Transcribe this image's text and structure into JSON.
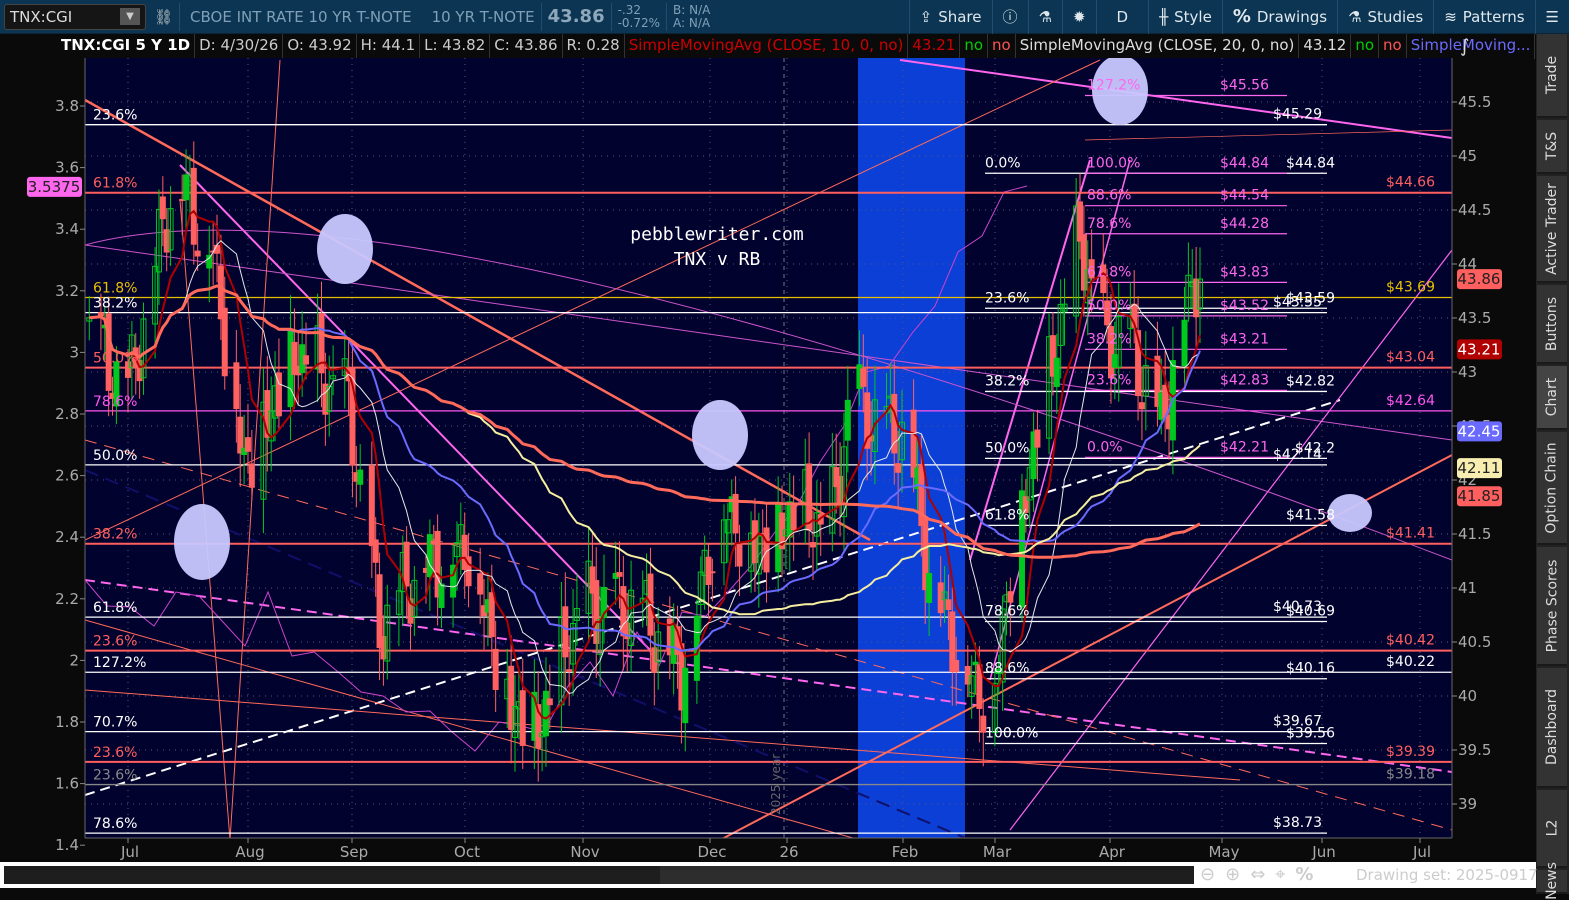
{
  "toolbar": {
    "symbol": "TNX:CGI",
    "description": "CBOE INT RATE 10 YR T-NOTE",
    "short_name": "10 YR T-NOTE",
    "last": "43.86",
    "change": "-.32",
    "change_pct": "-0.72%",
    "bid": "B: N/A",
    "ask": "A: N/A",
    "share": "Share",
    "period": "D",
    "style": "Style",
    "drawings": "Drawings",
    "studies": "Studies",
    "patterns": "Patterns"
  },
  "info": {
    "title": "TNX:CGI 5 Y 1D",
    "date": "D: 4/30/26",
    "open": "O: 43.92",
    "high": "H: 44.1",
    "low": "L: 43.82",
    "close": "C: 43.86",
    "range": "R: 0.28",
    "sma1": "SimpleMovingAvg (CLOSE, 10, 0, no)",
    "sma1_val": "43.21",
    "sma2": "SimpleMovingAvg (CLOSE, 20, 0, no)",
    "sma2_val": "43.12",
    "sma3": "SimpleMoving...",
    "no": "no"
  },
  "colors": {
    "bg": "#02022e",
    "up": "#00c81e",
    "down": "#ff6060",
    "sma10": "#b00000",
    "sma20": "#e8e8e8",
    "sma50": "#6a6aff",
    "sma100": "#f5eea0",
    "sma200": "#ff6a5a",
    "band": "#0b3fd6",
    "magenta": "#ff66ee"
  },
  "annotation": {
    "line1": "pebblewriter.com",
    "line2": "TNX v RB",
    "year_marker": "2025 year"
  },
  "right_axis": [
    "45.5",
    "45",
    "44.5",
    "44",
    "43.5",
    "43",
    "42.5",
    "42",
    "41.5",
    "41",
    "40.5",
    "40",
    "39.5",
    "39"
  ],
  "left_axis": [
    "3.8",
    "3.6",
    "3.4",
    "3.2",
    "3",
    "2.8",
    "2.6",
    "2.4",
    "2.2",
    "2",
    "1.8",
    "1.6",
    "1.4"
  ],
  "x_axis": [
    "Jul",
    "Aug",
    "Sep",
    "Oct",
    "Nov",
    "Dec",
    "26",
    "Feb",
    "Mar",
    "Apr",
    "May",
    "Jun",
    "Jul"
  ],
  "badges": [
    {
      "v": 43.86,
      "label": "43.86",
      "bg": "#ff5f5f",
      "fg": "#222"
    },
    {
      "v": 43.21,
      "label": "43.21",
      "bg": "#b00000",
      "fg": "#fff"
    },
    {
      "v": 42.45,
      "label": "42.45",
      "bg": "#6a6aff",
      "fg": "#fff"
    },
    {
      "v": 42.11,
      "label": "42.11",
      "bg": "#f8eeb0",
      "fg": "#222"
    },
    {
      "v": 41.85,
      "label": "41.85",
      "bg": "#ff5f5f",
      "fg": "#222"
    }
  ],
  "left_badge": "3.5375",
  "price_keypoints": [
    [
      -10,
      43.37
    ],
    [
      0,
      42.8
    ],
    [
      12,
      44.86
    ],
    [
      22,
      44.11
    ],
    [
      30,
      42.15
    ],
    [
      44,
      43.18
    ],
    [
      57,
      42.71
    ],
    [
      65,
      40.65
    ],
    [
      75,
      41.21
    ],
    [
      88,
      41.4
    ],
    [
      99,
      39.9
    ],
    [
      106,
      39.71
    ],
    [
      117,
      40.84
    ],
    [
      132,
      40.84
    ],
    [
      143,
      40.28
    ],
    [
      153,
      41.77
    ],
    [
      163,
      41.4
    ],
    [
      174,
      41.77
    ],
    [
      181,
      41.49
    ],
    [
      187,
      42.8
    ],
    [
      194,
      42.52
    ],
    [
      201,
      42.43
    ],
    [
      207,
      41.21
    ],
    [
      215,
      40.37
    ],
    [
      223,
      39.9
    ],
    [
      228,
      41.21
    ],
    [
      236,
      42.71
    ],
    [
      246,
      44.3
    ],
    [
      251,
      43.37
    ],
    [
      259,
      43.27
    ],
    [
      267,
      42.52
    ],
    [
      272,
      43.46
    ],
    [
      277,
      44.02
    ],
    [
      278,
      43.86
    ]
  ],
  "levels": [
    {
      "v": 45.29,
      "pct": "23.6%",
      "price": "$45.29",
      "color": "#ffffff",
      "g": "lw"
    },
    {
      "v": 44.66,
      "pct": "61.8%",
      "price": "$44.66",
      "color": "#ff5f5f",
      "g": "full"
    },
    {
      "v": 43.69,
      "pct": "61.8%",
      "price": "$43.69",
      "color": "#e8c000",
      "g": "full"
    },
    {
      "v": 43.55,
      "pct": "38.2%",
      "price": "$43.55",
      "color": "#ffffff",
      "g": "lw"
    },
    {
      "v": 43.04,
      "pct": "50.0%",
      "price": "$43.04",
      "color": "#ff5f5f",
      "g": "full"
    },
    {
      "v": 42.64,
      "pct": "78.6%",
      "price": "$42.64",
      "color": "#ff55ee",
      "g": "full"
    },
    {
      "v": 42.14,
      "pct": "50.0%",
      "price": "$42.14",
      "color": "#ffffff",
      "g": "lw"
    },
    {
      "v": 41.41,
      "pct": "38.2%",
      "price": "$41.41",
      "color": "#ff5f5f",
      "g": "full"
    },
    {
      "v": 40.73,
      "pct": "61.8%",
      "price": "$40.73",
      "color": "#ffffff",
      "g": "lw"
    },
    {
      "v": 40.42,
      "pct": "23.6%",
      "price": "$40.42",
      "color": "#ff5f5f",
      "g": "full"
    },
    {
      "v": 40.22,
      "pct": "127.2%",
      "price": "$40.22",
      "color": "#ffffff",
      "g": "full"
    },
    {
      "v": 39.67,
      "pct": "70.7%",
      "price": "$39.67",
      "color": "#ffffff",
      "g": "lw"
    },
    {
      "v": 39.39,
      "pct": "23.6%",
      "price": "$39.39",
      "color": "#ff5f5f",
      "g": "full"
    },
    {
      "v": 39.18,
      "pct": "23.6%",
      "price": "$39.18",
      "color": "#888888",
      "g": "full"
    },
    {
      "v": 38.73,
      "pct": "78.6%",
      "price": "$38.73",
      "color": "#ffffff",
      "g": "lw"
    }
  ],
  "fib_mid": [
    {
      "v": 44.84,
      "pct": "0.0%",
      "price": "$44.84"
    },
    {
      "v": 43.59,
      "pct": "23.6%",
      "price": "$43.59"
    },
    {
      "v": 42.82,
      "pct": "38.2%",
      "price": "$42.82"
    },
    {
      "v": 42.2,
      "pct": "50.0%",
      "price": "$42.2"
    },
    {
      "v": 41.58,
      "pct": "61.8%",
      "price": "$41.58"
    },
    {
      "v": 40.69,
      "pct": "78.6%",
      "price": "$40.69"
    },
    {
      "v": 40.16,
      "pct": "88.6%",
      "price": "$40.16"
    },
    {
      "v": 39.56,
      "pct": "100.0%",
      "price": "$39.56"
    }
  ],
  "fib_magenta": [
    {
      "v": 45.56,
      "pct": "127.2%",
      "price": "$45.56"
    },
    {
      "v": 44.84,
      "pct": "100.0%",
      "price": "$44.84"
    },
    {
      "v": 44.54,
      "pct": "88.6%",
      "price": "$44.54"
    },
    {
      "v": 44.28,
      "pct": "78.6%",
      "price": "$44.28"
    },
    {
      "v": 43.83,
      "pct": "61.8%",
      "price": "$43.83"
    },
    {
      "v": 43.52,
      "pct": "50.0%",
      "price": "$43.52"
    },
    {
      "v": 43.21,
      "pct": "38.2%",
      "price": "$43.21"
    },
    {
      "v": 42.83,
      "pct": "23.6%",
      "price": "$42.83"
    },
    {
      "v": 42.21,
      "pct": "0.0%",
      "price": "$42.21"
    }
  ],
  "sidebar": [
    "Trade",
    "T&S",
    "Active Trader",
    "Buttons",
    "Chart",
    "Option Chain",
    "Phase Scores",
    "Dashboard",
    "L2",
    "News"
  ],
  "bottom": {
    "drawing_set": "Drawing set: 2025-0917"
  }
}
